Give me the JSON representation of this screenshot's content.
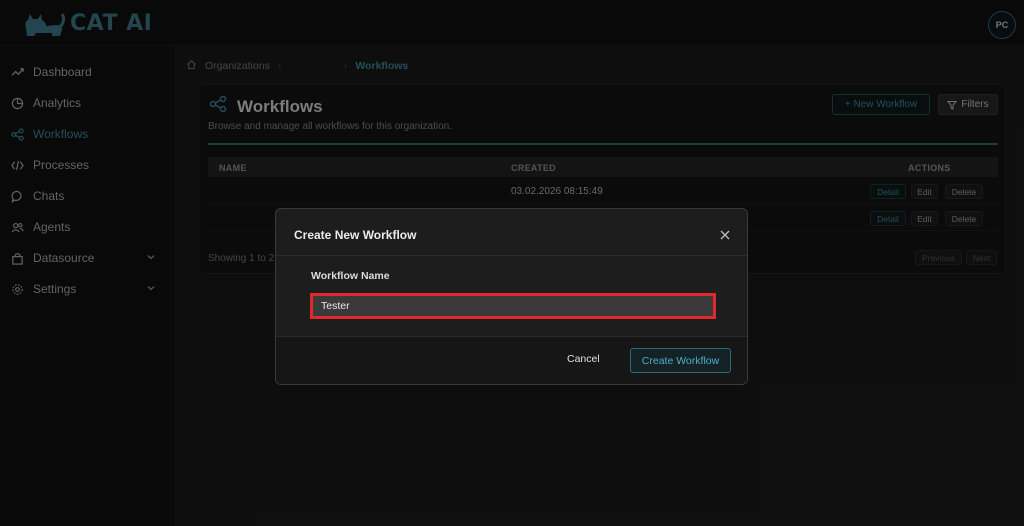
{
  "app": {
    "logo_text": "CAT AI",
    "avatar_initials": "PC"
  },
  "sidebar": {
    "items": [
      {
        "label": "Dashboard",
        "icon": "trend-icon"
      },
      {
        "label": "Analytics",
        "icon": "pie-chart-icon"
      },
      {
        "label": "Workflows",
        "icon": "share-icon",
        "active": true
      },
      {
        "label": "Processes",
        "icon": "code-icon"
      },
      {
        "label": "Chats",
        "icon": "chat-bubble-icon"
      },
      {
        "label": "Agents",
        "icon": "users-icon"
      },
      {
        "label": "Datasource",
        "icon": "bag-icon",
        "expandable": true
      },
      {
        "label": "Settings",
        "icon": "gear-icon",
        "expandable": true
      }
    ]
  },
  "breadcrumb": {
    "root": "Organizations",
    "current": "Workflows"
  },
  "page": {
    "title": "Workflows",
    "subtitle": "Browse and manage all workflows for this organization.",
    "new_button": "+ New Workflow",
    "filter_button": "Filters",
    "progress_fraction": 1.0
  },
  "table": {
    "headers": {
      "name": "NAME",
      "created": "CREATED",
      "actions": "ACTIONS"
    },
    "rows": [
      {
        "created": "03.02.2026 08:15:49"
      },
      {
        "created": ""
      }
    ],
    "actions": {
      "detail": "Detail",
      "edit": "Edit",
      "delete": "Delete"
    },
    "showing": "Showing 1 to 2",
    "pagination": {
      "previous": "Previous",
      "next": "Next"
    }
  },
  "modal": {
    "title": "Create New Workflow",
    "field_label": "Workflow Name",
    "field_value": "Tester",
    "cancel": "Cancel",
    "submit": "Create Workflow"
  },
  "colors": {
    "accent": "#3f8fa3",
    "highlight_border": "#e0292e"
  }
}
